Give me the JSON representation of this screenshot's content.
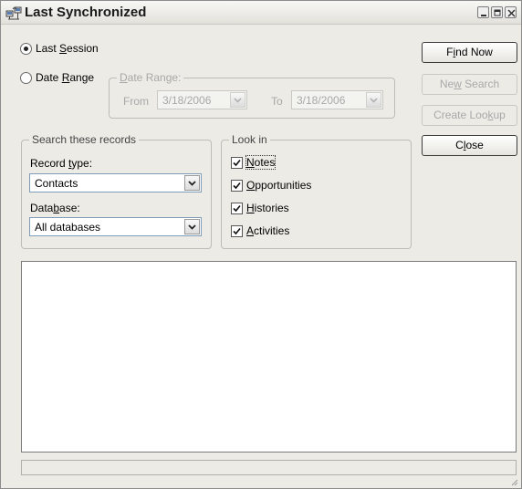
{
  "window": {
    "title": "Last Synchronized",
    "icon": "network-computers-icon"
  },
  "options": {
    "last_session": {
      "pre": "Last ",
      "accel": "S",
      "post": "ession",
      "checked": true
    },
    "date_range": {
      "pre": "Date ",
      "accel": "R",
      "post": "ange",
      "checked": false
    }
  },
  "date_range_group": {
    "label_accel": "D",
    "label_rest": "ate Range:",
    "from_label": "From",
    "from_value": "3/18/2006",
    "to_label": "To",
    "to_value": "3/18/2006"
  },
  "search_group": {
    "label": "Search these records",
    "record_type_label_pre": "Record ",
    "record_type_label_accel": "t",
    "record_type_label_post": "ype:",
    "record_type_value": "Contacts",
    "database_label_pre": "Data",
    "database_label_accel": "b",
    "database_label_post": "ase:",
    "database_value": "All databases"
  },
  "look_in_group": {
    "label": "Look in",
    "items": [
      {
        "accel": "N",
        "rest": "otes",
        "checked": true
      },
      {
        "accel": "O",
        "rest": "pportunities",
        "checked": true
      },
      {
        "accel": "H",
        "rest": "istories",
        "checked": true
      },
      {
        "accel": "A",
        "rest": "ctivities",
        "checked": true
      }
    ]
  },
  "buttons": {
    "find_now": {
      "pre": "F",
      "accel": "i",
      "post": "nd Now",
      "enabled": true
    },
    "new_search": {
      "pre": "Ne",
      "accel": "w",
      "post": " Search",
      "enabled": false
    },
    "create_lookup": {
      "pre": "Create Loo",
      "accel": "k",
      "post": "up",
      "enabled": false
    },
    "close": {
      "pre": "C",
      "accel": "l",
      "post": "ose",
      "enabled": true
    }
  },
  "colors": {
    "window_bg": "#ecebe6",
    "disabled_text": "#a8a8a8",
    "combo_border": "#7f9db9"
  }
}
